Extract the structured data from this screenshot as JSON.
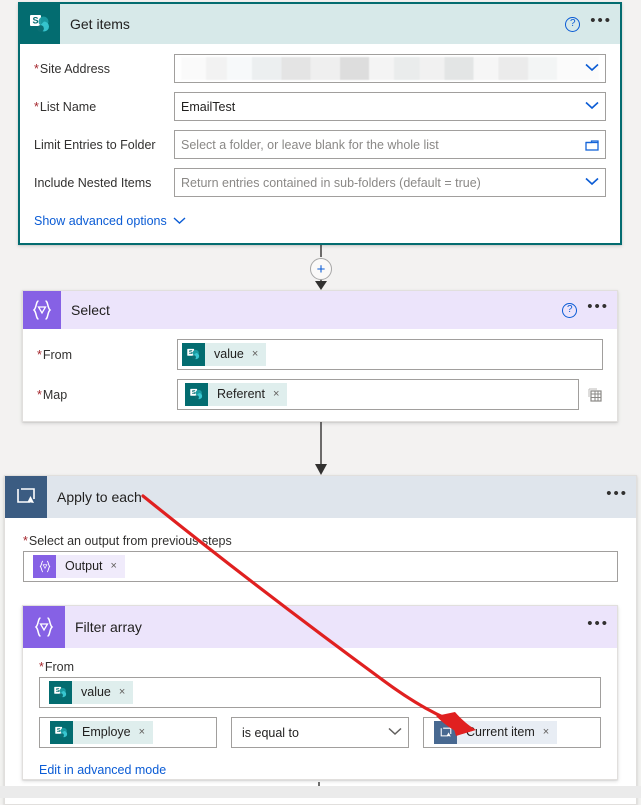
{
  "meta": {
    "accent_sharepoint": "#036c70",
    "accent_dataops": "#8661e5",
    "accent_loop": "#3b5c82",
    "annotation_color": "#e02020",
    "canvas_bg": "#f3f2f1"
  },
  "get_items": {
    "title": "Get items",
    "icon": "sharepoint-icon",
    "help_label": "?",
    "more_label": "•••",
    "fields": [
      {
        "label": "Site Address",
        "required": true,
        "value": "",
        "redacted": true,
        "control": "dropdown"
      },
      {
        "label": "List Name",
        "required": true,
        "value": "EmailTest",
        "placeholder": "",
        "control": "dropdown"
      },
      {
        "label": "Limit Entries to Folder",
        "required": false,
        "value": "",
        "placeholder": "Select a folder, or leave blank for the whole list",
        "control": "folder-picker"
      },
      {
        "label": "Include Nested Items",
        "required": false,
        "value": "",
        "placeholder": "Return entries contained in sub-folders (default = true)",
        "control": "dropdown"
      }
    ],
    "advanced_link": "Show advanced options"
  },
  "select": {
    "title": "Select",
    "icon": "data-operations-icon",
    "help_label": "?",
    "more_label": "•••",
    "from": {
      "label": "From",
      "required": true,
      "token": {
        "text": "value",
        "icon": "sharepoint-icon",
        "remove": "×"
      }
    },
    "map": {
      "label": "Map",
      "required": true,
      "token": {
        "text": "Referent",
        "icon": "sharepoint-icon",
        "remove": "×"
      },
      "table_toggle": "table-view-icon"
    }
  },
  "apply_to_each": {
    "title": "Apply to each",
    "icon": "loop-icon",
    "more_label": "•••",
    "output_label": "Select an output from previous steps",
    "output_required": true,
    "output_token": {
      "text": "Output",
      "icon": "data-operations-icon",
      "remove": "×"
    }
  },
  "filter_array": {
    "title": "Filter array",
    "icon": "data-operations-icon",
    "more_label": "•••",
    "from_label": "From",
    "from_required": true,
    "from_token": {
      "text": "value",
      "icon": "sharepoint-icon",
      "remove": "×"
    },
    "condition": {
      "left_token": {
        "text": "Employe",
        "icon": "sharepoint-icon",
        "remove": "×"
      },
      "operator": "is equal to",
      "right_token": {
        "text": "Current item",
        "icon": "loop-icon",
        "remove": "×"
      }
    },
    "advanced_link": "Edit in advanced mode"
  },
  "connectors": {
    "add_step_label": "+"
  }
}
